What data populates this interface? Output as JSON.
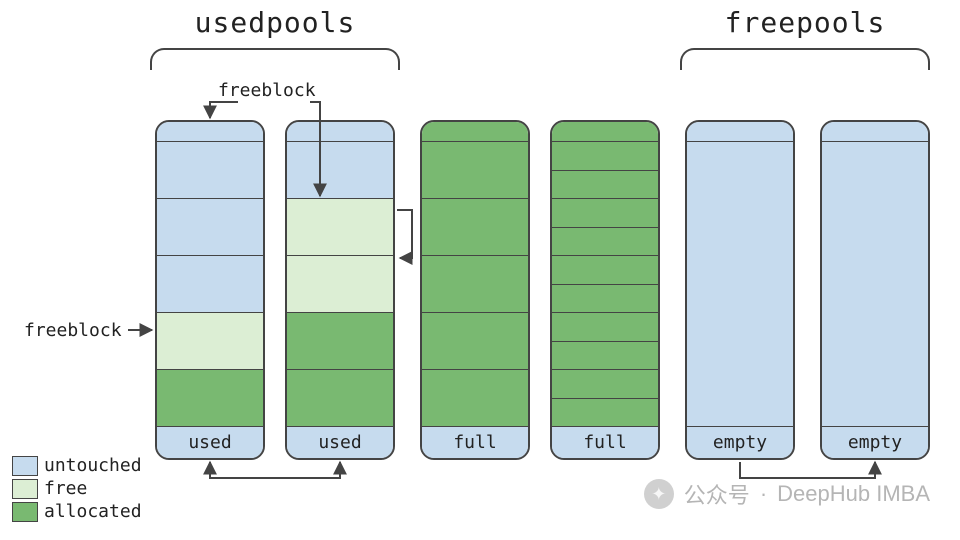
{
  "titles": {
    "used": "usedpools",
    "free": "freepools"
  },
  "annotations": {
    "freeblock_top": "freeblock",
    "freeblock_left": "freeblock"
  },
  "legend": {
    "untouched": "untouched",
    "free": "free",
    "allocated": "allocated"
  },
  "pools": {
    "used1": {
      "footer": "used",
      "blocks": [
        "untouched",
        "untouched",
        "untouched",
        "free",
        "allocated"
      ]
    },
    "used2": {
      "footer": "used",
      "blocks": [
        "untouched",
        "free",
        "free",
        "allocated",
        "allocated"
      ]
    },
    "full1": {
      "footer": "full",
      "blocks": [
        "allocated",
        "allocated",
        "allocated",
        "allocated",
        "allocated"
      ]
    },
    "full2": {
      "footer": "full",
      "blocks": [
        "allocated",
        "allocated",
        "allocated",
        "allocated",
        "allocated",
        "allocated",
        "allocated",
        "allocated",
        "allocated",
        "allocated"
      ]
    },
    "empty1": {
      "footer": "empty",
      "blocks": [
        "untouched"
      ]
    },
    "empty2": {
      "footer": "empty",
      "blocks": [
        "untouched"
      ]
    }
  },
  "watermark": {
    "label1": "公众号",
    "sep": "·",
    "label2": "DeepHub IMBA"
  },
  "colors": {
    "untouched": "#c6dbee",
    "free": "#dceed4",
    "allocated": "#79b971",
    "line": "#444"
  }
}
